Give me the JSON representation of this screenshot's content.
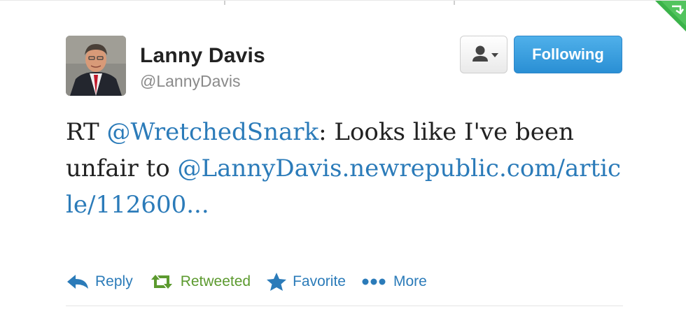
{
  "tweet": {
    "author": {
      "name": "Lanny Davis",
      "handle": "@LannyDavis",
      "avatar_icon": "profile-photo"
    },
    "buttons": {
      "user_menu_icon": "person-dropdown-icon",
      "follow_label": "Following"
    },
    "text": {
      "prefix": "RT ",
      "mention": "@WretchedSnark",
      "middle": ": Looks like I've been unfair to ",
      "link": "@LannyDavis.newrepublic.com/article/112600..."
    },
    "actions": {
      "reply": "Reply",
      "retweet": "Retweeted",
      "favorite": "Favorite",
      "more": "More"
    }
  },
  "colors": {
    "link": "#2b7bb9",
    "follow_button": "#2a8fd4",
    "retweeted": "#5c9a2f",
    "name": "#222222",
    "handle": "#8a8a8a",
    "corner_badge": "#3bb34a"
  }
}
